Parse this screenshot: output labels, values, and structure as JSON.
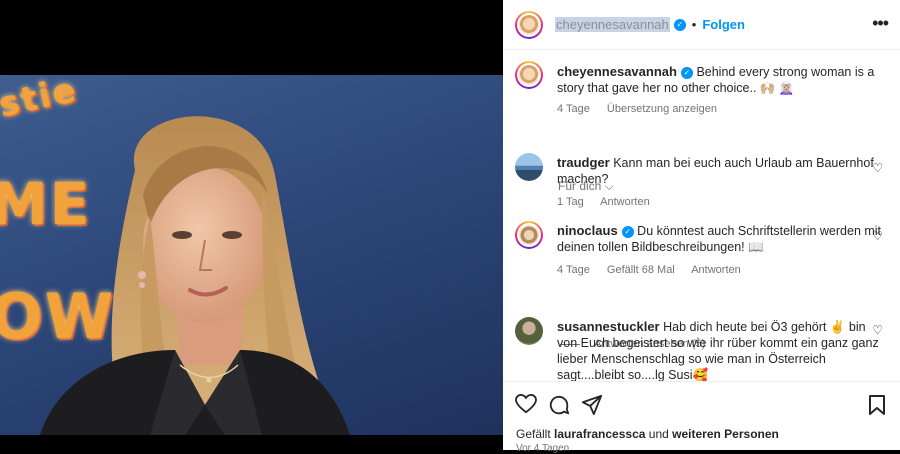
{
  "header": {
    "username": "cheyennesavannah",
    "separator": "•",
    "follow_label": "Folgen",
    "more_icon": "more-horizontal-icon"
  },
  "caption": {
    "username": "cheyennesavannah",
    "text": "Behind every strong woman is a story that gave her no other choice.. 🙌🏼 🧝🏼‍♀️",
    "time": "4 Tage",
    "translate": "Übersetzung anzeigen"
  },
  "for_you": "Für dich ⌵",
  "comments": [
    {
      "username": "traudger",
      "text": "Kann man bei euch auch Urlaub am Bauernhof machen?",
      "time": "1 Tag",
      "likes": "",
      "reply": "Antworten"
    },
    {
      "username": "ninoclaus",
      "text": "Du könntest auch Schriftstellerin werden mit deinen tollen Bildbeschreibungen! 📖",
      "time": "4 Tage",
      "likes": "Gefällt 68 Mal",
      "reply": "Antworten"
    },
    {
      "username": "susannestuckler",
      "text": "Hab dich heute bei Ö3 gehört ✌️ bin von Euch begeistert so wie ihr rüber kommt ein ganz ganz lieber Menschenschlag so wie man in Österreich sagt....bleibt so....lg Susi🥰",
      "time": "",
      "likes": "",
      "reply": ""
    }
  ],
  "view_replies": "Antworten ansehen (5)",
  "likes_line": {
    "prefix": "Gefällt",
    "user": "laurafrancessca",
    "middle": "und",
    "rest": "weiteren Personen"
  },
  "post_time": "Vor 4 Tagen",
  "media": {
    "sign_text_1": "istie",
    "sign_text_2": "ME",
    "sign_text_3": "OW"
  },
  "colors": {
    "accent": "#0095f6",
    "text": "#262626",
    "muted": "#737373"
  }
}
